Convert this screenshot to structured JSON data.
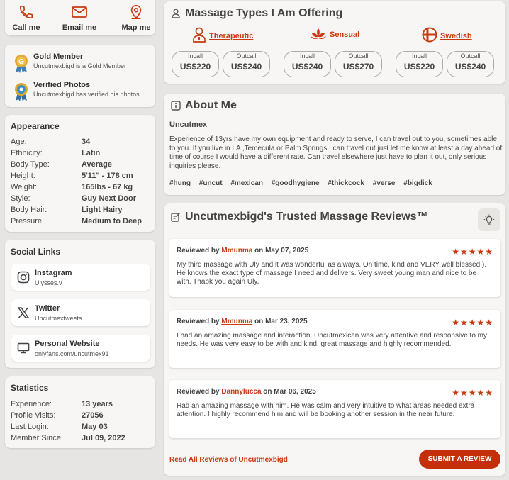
{
  "contact": {
    "call": "Call me",
    "email": "Email me",
    "map": "Map me"
  },
  "badges": [
    {
      "title": "Gold Member",
      "sub": "Uncutmexbigd is a Gold Member",
      "color": "#d9a12a"
    },
    {
      "title": "Verified Photos",
      "sub": "Uncutmexbigd has verified his photos",
      "color": "#3b8fc7"
    }
  ],
  "appearance": {
    "heading": "Appearance",
    "rows": [
      {
        "k": "Age:",
        "v": "34"
      },
      {
        "k": "Ethnicity:",
        "v": "Latin"
      },
      {
        "k": "Body Type:",
        "v": "Average"
      },
      {
        "k": "Height:",
        "v": "5'11\" - 178 cm"
      },
      {
        "k": "Weight:",
        "v": "165lbs - 67 kg"
      },
      {
        "k": "Style:",
        "v": "Guy Next Door"
      },
      {
        "k": "Body Hair:",
        "v": "Light Hairy"
      },
      {
        "k": "Pressure:",
        "v": "Medium to Deep"
      }
    ]
  },
  "social": {
    "heading": "Social Links",
    "links": [
      {
        "title": "Instagram",
        "sub": "Ulysses.v",
        "icon": "instagram-icon"
      },
      {
        "title": "Twitter",
        "sub": "Uncutmextweets",
        "icon": "x-icon"
      },
      {
        "title": "Personal Website",
        "sub": "onlyfans.com/uncutmex91",
        "icon": "monitor-icon"
      }
    ]
  },
  "stats": {
    "heading": "Statistics",
    "rows": [
      {
        "k": "Experience:",
        "v": "13 years"
      },
      {
        "k": "Profile Visits:",
        "v": "27056"
      },
      {
        "k": "Last Login:",
        "v": "May 03"
      },
      {
        "k": "Member Since:",
        "v": "Jul 09, 2022"
      }
    ]
  },
  "types": {
    "title": "Massage Types I Am Offering",
    "items": [
      {
        "name": "Therapeutic",
        "icon": "therapist-icon",
        "incall_label": "Incall",
        "incall": "US$220",
        "outcall_label": "Outcall",
        "outcall": "US$240"
      },
      {
        "name": "Sensual",
        "icon": "lotus-icon",
        "incall_label": "Incall",
        "incall": "US$240",
        "outcall_label": "Outcall",
        "outcall": "US$270"
      },
      {
        "name": "Swedish",
        "icon": "swedish-flag-icon",
        "incall_label": "Incall",
        "incall": "US$220",
        "outcall_label": "Outcall",
        "outcall": "US$240"
      }
    ]
  },
  "about": {
    "title": "About Me",
    "name": "Uncutmex",
    "text": "Experience of 13yrs have my own equipment and ready to serve, I can travel out to you, sometimes able to you. If you live in LA ,Temecula or Palm Springs I can travel out just let me know at least a day ahead of time of course I would have a different rate. Can travel elsewhere just have to plan it out, only serious inquiries please.",
    "tags": [
      "#hung",
      "#uncut",
      "#mexican",
      "#goodhygiene",
      "#thickcock",
      "#verse",
      "#bigdick"
    ]
  },
  "reviews": {
    "title": "Uncutmexbigd's Trusted Massage Reviews™",
    "items": [
      {
        "prefix": "Reviewed by",
        "reviewer": "Mmunma",
        "on": "on",
        "date": "May 07, 2025",
        "stars": "★★★★★",
        "rating": 5,
        "text": "My third massage with Uly and it was wonderful as always. On time, kind and VERY well blessed;). He knows the exact type of massage I need and delivers. Very sweet young man and nice to be with. Thabk you again Uly."
      },
      {
        "prefix": "Reviewed by",
        "reviewer": "Mmunma",
        "on": "on",
        "date": "Mar 23, 2025",
        "stars": "★★★★★",
        "rating": 5,
        "text": "I had an amazing massage and interaction. Uncutmexican was very attentive and responsive to my needs. He was very easy to be with and kind, great massage and highly recommended."
      },
      {
        "prefix": "Reviewed by",
        "reviewer": "Dannylucca",
        "on": "on",
        "date": "Mar 06, 2025",
        "stars": "★★★★★",
        "rating": 5,
        "text": "Had an amazing massage with him. He was calm and very intuitive to what areas needed extra attention. I highly recommend him and will be booking another session in the near future."
      }
    ],
    "read_all": "Read All Reviews of Uncutmexbigd",
    "submit": "SUBMIT A REVIEW"
  },
  "colors": {
    "accent": "#c93a10",
    "button": "#c42f0a",
    "background": "#e6e5e3",
    "card": "#f7f6f4"
  }
}
